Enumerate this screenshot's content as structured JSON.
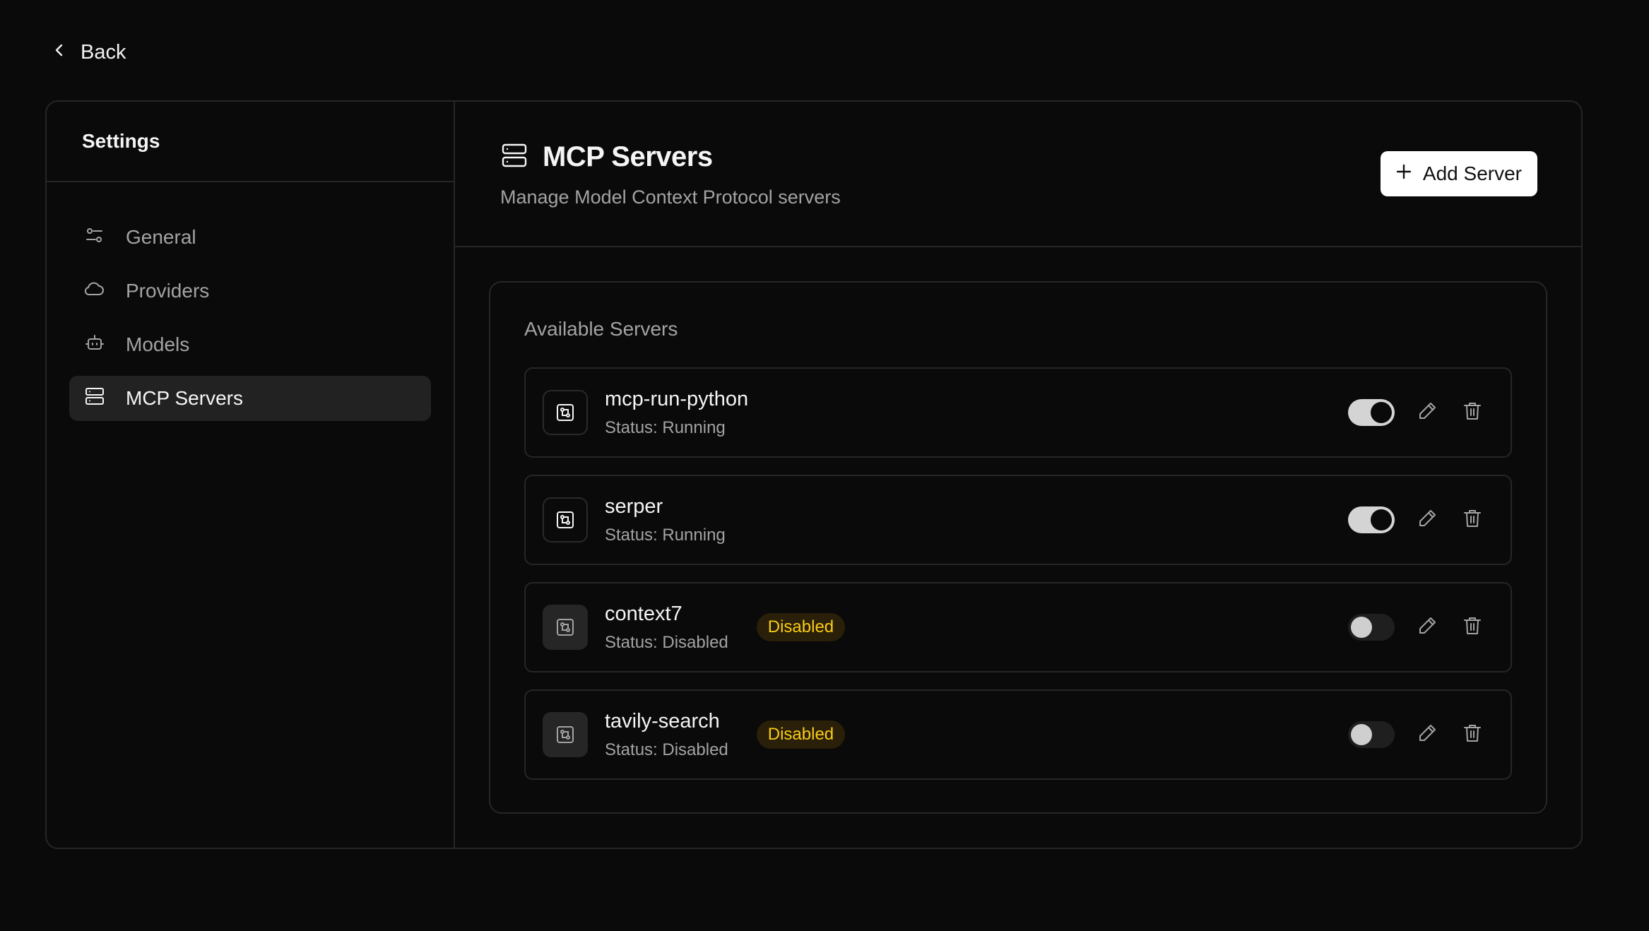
{
  "back": {
    "label": "Back",
    "icon": "chevron-left-icon"
  },
  "sidebar": {
    "title": "Settings",
    "items": [
      {
        "label": "General",
        "icon": "sliders-icon",
        "active": false
      },
      {
        "label": "Providers",
        "icon": "cloud-icon",
        "active": false
      },
      {
        "label": "Models",
        "icon": "bot-icon",
        "active": false
      },
      {
        "label": "MCP Servers",
        "icon": "server-icon",
        "active": true
      }
    ]
  },
  "header": {
    "title": "MCP Servers",
    "subtitle": "Manage Model Context Protocol servers",
    "add_button": "Add Server",
    "icon": "server-icon"
  },
  "panel": {
    "title": "Available Servers",
    "servers": [
      {
        "name": "mcp-run-python",
        "status": "Status: Running",
        "badge": "",
        "enabled": true
      },
      {
        "name": "serper",
        "status": "Status: Running",
        "badge": "",
        "enabled": true
      },
      {
        "name": "context7",
        "status": "Status: Disabled",
        "badge": "Disabled",
        "enabled": false
      },
      {
        "name": "tavily-search",
        "status": "Status: Disabled",
        "badge": "Disabled",
        "enabled": false
      }
    ]
  },
  "colors": {
    "background": "#0a0a0a",
    "border": "#262626",
    "accent_badge_text": "#facc15",
    "accent_badge_bg": "#2a1f08",
    "active_nav_bg": "#222222"
  }
}
